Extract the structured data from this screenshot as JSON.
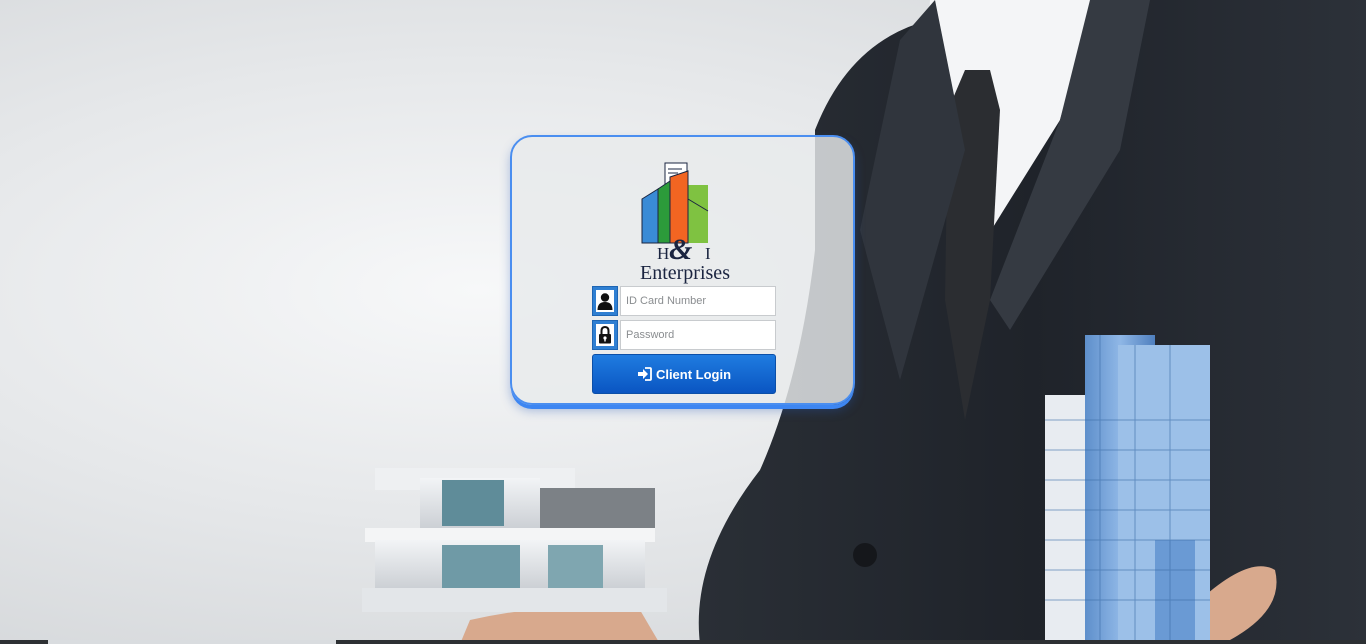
{
  "brand": {
    "logo_top": "H",
    "logo_amp": "&",
    "logo_right": "I",
    "name": "Enterprises"
  },
  "login": {
    "id_placeholder": "ID Card Number",
    "password_placeholder": "Password",
    "button_label": "Client Login"
  },
  "icons": {
    "id_field": "user-icon",
    "password_field": "lock-icon",
    "button": "sign-in-icon"
  },
  "colors": {
    "accent": "#2f7fd2",
    "button": "#0a55c2",
    "card_border": "#4a8ef0"
  }
}
